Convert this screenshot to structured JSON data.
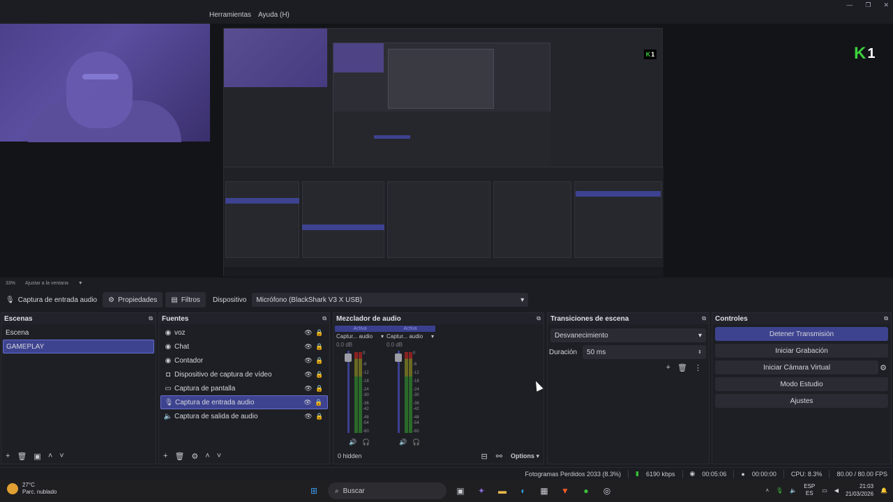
{
  "menu": {
    "tools": "Herramientas",
    "help": "Ayuda (H)"
  },
  "preview": {
    "brand_logo": "K1",
    "zoom_label": "33%",
    "fit_label": "Ajustar a la ventana"
  },
  "source_toolbar": {
    "source_name": "Captura de entrada audio",
    "properties": "Propiedades",
    "filters": "Filtros",
    "device_label": "Dispositivo",
    "device_value": "Micrófono (BlackShark V3 X USB)"
  },
  "scenes": {
    "title": "Escenas",
    "items": [
      {
        "label": "Escena",
        "selected": false
      },
      {
        "label": "GAMEPLAY",
        "selected": true
      }
    ]
  },
  "sources": {
    "title": "Fuentes",
    "items": [
      {
        "label": "voz",
        "icon": "globe-icon"
      },
      {
        "label": "Chat",
        "icon": "globe-icon"
      },
      {
        "label": "Contador",
        "icon": "globe-icon"
      },
      {
        "label": "Dispositivo de captura de vídeo",
        "icon": "camera-icon"
      },
      {
        "label": "Captura de pantalla",
        "icon": "monitor-icon"
      },
      {
        "label": "Captura de entrada audio",
        "icon": "microphone-icon",
        "selected": true
      },
      {
        "label": "Captura de salida de audio",
        "icon": "speaker-icon"
      }
    ]
  },
  "mixer": {
    "title": "Mezclador de audio",
    "channels": [
      {
        "active": "Activa",
        "name": "Captur... audio",
        "db": "0.0 dB"
      },
      {
        "active": "Activa",
        "name": "Captur... audio",
        "db": "0.0 dB"
      }
    ],
    "scale": [
      "0",
      "-6",
      "-12",
      "-18",
      "-24",
      "-30",
      "-36",
      "-42",
      "-48",
      "-54",
      "-60"
    ],
    "hidden": "0 hidden",
    "options": "Options"
  },
  "transitions": {
    "title": "Transiciones de escena",
    "selected": "Desvanecimiento",
    "duration_label": "Duración",
    "duration_value": "50 ms"
  },
  "controls": {
    "title": "Controles",
    "stop_stream": "Detener Transmisión",
    "start_recording": "Iniciar Grabación",
    "virtual_cam": "Iniciar Cámara Virtual",
    "studio_mode": "Modo Estudio",
    "settings": "Ajustes"
  },
  "status": {
    "dropped_frames": "Fotogramas Perdidos 2033 (8.3%)",
    "bitrate": "6190 kbps",
    "stream_time": "00:05:06",
    "rec_time": "00:00:00",
    "cpu": "CPU: 8.3%",
    "fps": "80.00 / 80.00 FPS"
  },
  "taskbar": {
    "temperature": "27°C",
    "weather": "Parc. nublado",
    "search": "Buscar",
    "lang_top": "ESP",
    "lang_bottom": "ES",
    "time": "21:03",
    "date": "21/03/2026"
  },
  "colors": {
    "accent": "#3d438f",
    "brand_green": "#3bd23b"
  }
}
